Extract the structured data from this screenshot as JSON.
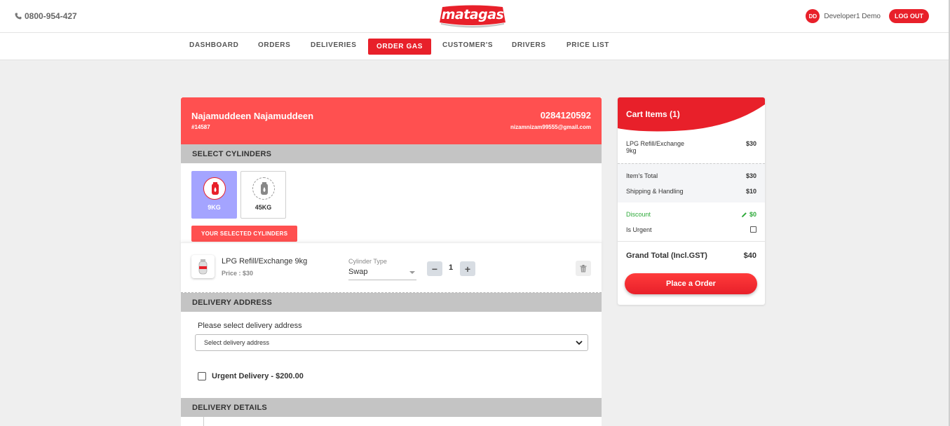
{
  "header": {
    "phone": "0800-954-427",
    "logo_text": "matagas",
    "user_initials": "DD",
    "user_name": "Developer1 Demo",
    "logout_label": "LOG OUT"
  },
  "nav": {
    "items": [
      "DASHBOARD",
      "ORDERS",
      "DELIVERIES",
      "ORDER GAS",
      "CUSTOMER'S",
      "DRIVERS",
      "PRICE LIST"
    ],
    "active": "ORDER GAS"
  },
  "customer": {
    "name": "Najamuddeen Najamuddeen",
    "id": "#14587",
    "phone": "0284120592",
    "email": "nizamnizam99555@gmail.com"
  },
  "select_cylinders": {
    "heading": "SELECT CYLINDERS",
    "options": [
      {
        "label": "9KG",
        "selected": true
      },
      {
        "label": "45KG",
        "selected": false
      }
    ],
    "selected_badge": "YOUR SELECTED CYLINDERS"
  },
  "selected_item": {
    "name": "LPG Refill/Exchange 9kg",
    "price": "Price : $30",
    "cylinder_type_label": "Cylinder Type",
    "cylinder_type_value": "Swap",
    "qty_minus": "−",
    "qty_plus": "+",
    "quantity": "1"
  },
  "delivery_address": {
    "heading": "DELIVERY ADDRESS",
    "prompt": "Please select delivery address",
    "select_value": "Select delivery address",
    "urgent_label": "Urgent Delivery - $200.00",
    "urgent_checked": false
  },
  "delivery_details": {
    "heading": "DELIVERY DETAILS"
  },
  "cart": {
    "title": "Cart Items (1)",
    "item_name_line1": "LPG Refill/Exchange",
    "item_name_line2": "9kg",
    "item_price": "$30",
    "items_total_label": "Item's Total",
    "items_total": "$30",
    "shipping_label": "Shipping & Handling",
    "shipping": "$10",
    "discount_label": "Discount",
    "discount": "$0",
    "urgent_label": "Is Urgent",
    "grand_label": "Grand Total (Incl.GST)",
    "grand_total": "$40",
    "place_order_label": "Place a Order"
  },
  "colors": {
    "brand_red": "#e8202a",
    "header_red": "#ff5050",
    "selected_cylinder": "#a4a4ff",
    "discount_green": "#2eaa3a"
  }
}
